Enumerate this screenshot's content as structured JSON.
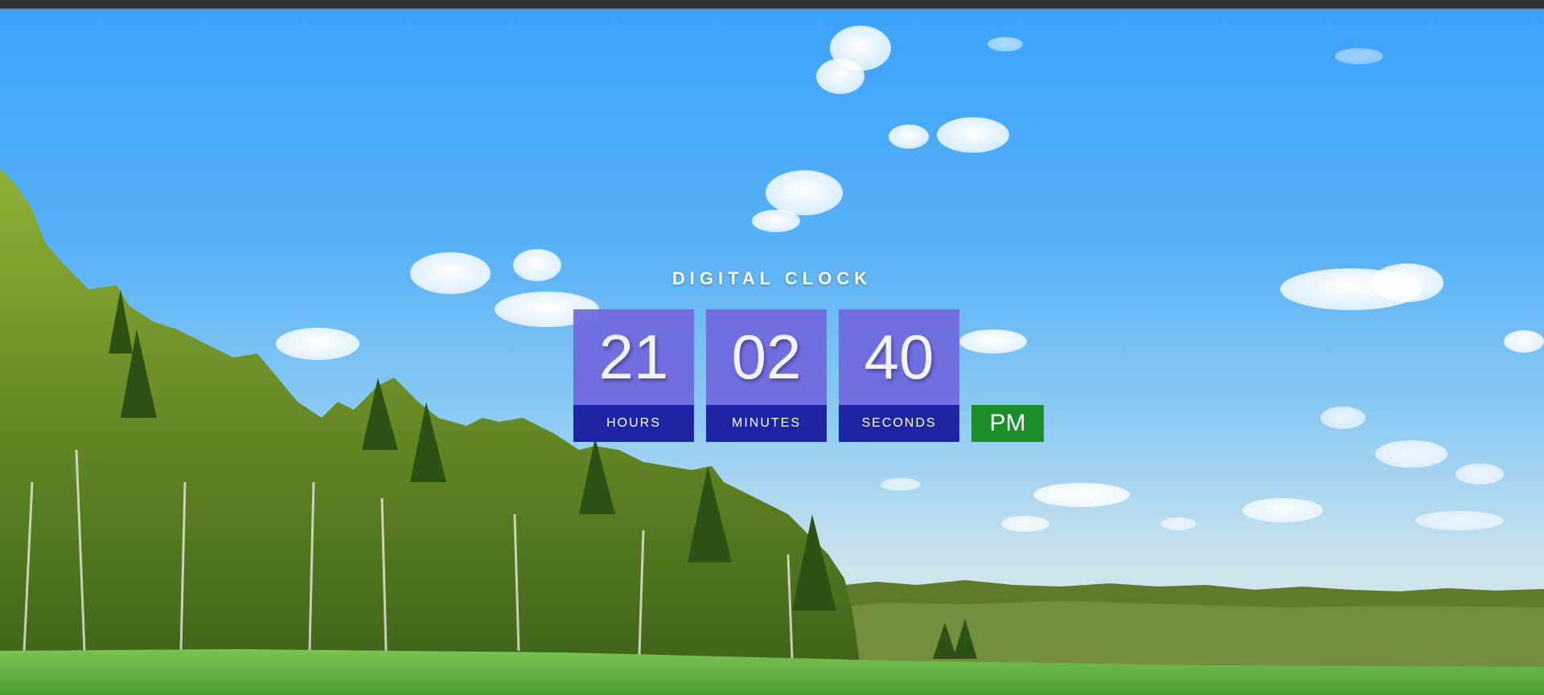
{
  "clock": {
    "title": "DIGITAL CLOCK",
    "hours": {
      "value": "21",
      "label": "HOURS"
    },
    "minutes": {
      "value": "02",
      "label": "MINUTES"
    },
    "seconds": {
      "value": "40",
      "label": "SECONDS"
    },
    "period": "PM"
  },
  "colors": {
    "digit_box": "#7068de",
    "label_box": "#1f24a5",
    "period_box": "#1d8d2c",
    "sky": "#3aa2fb",
    "grass": "#5fae3a"
  },
  "background": {
    "scene": "landscape-photo"
  }
}
